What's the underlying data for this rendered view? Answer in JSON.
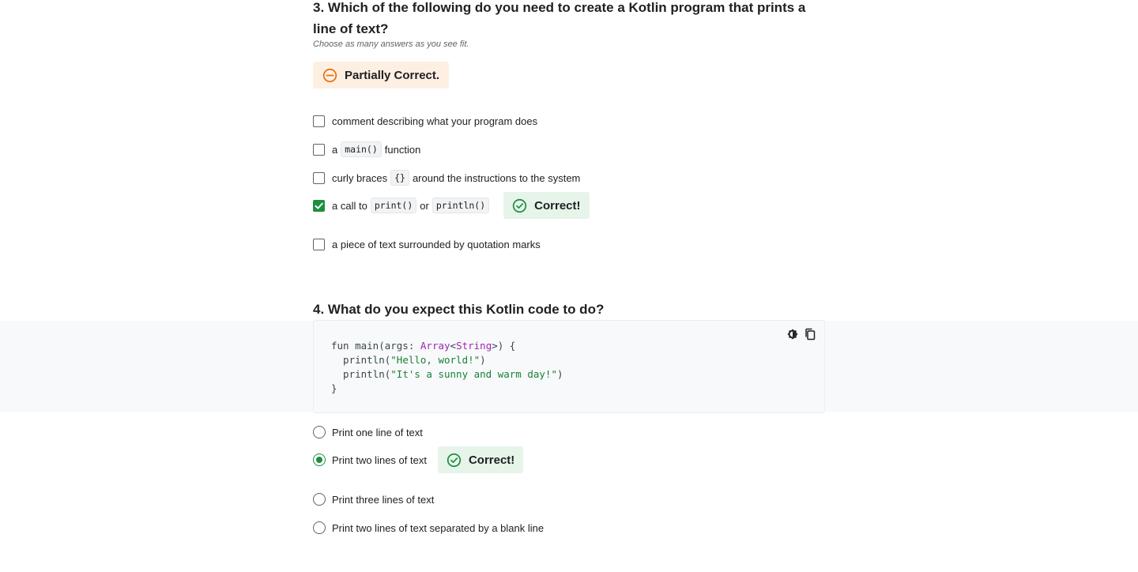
{
  "q3": {
    "title": "3. Which of the following do you need to create a Kotlin program that prints a line of text?",
    "hint": "Choose as many answers as you see fit.",
    "result": "Partially Correct.",
    "options": [
      {
        "label": "comment describing what your program does",
        "checked": false
      },
      {
        "pre": "a",
        "code": "main()",
        "post": "function",
        "checked": false
      },
      {
        "pre": "curly braces",
        "code": "{}",
        "post": "around the instructions to the system",
        "checked": false
      },
      {
        "pre": "a call to",
        "code": "print()",
        "mid": "or",
        "code2": "println()",
        "checked": true,
        "feedback": "Correct!"
      },
      {
        "label": "a piece of text surrounded by quotation marks",
        "checked": false
      }
    ]
  },
  "q4": {
    "title": "4. What do you expect this Kotlin code to do?",
    "code": {
      "line1_a": "fun main(args: ",
      "line1_type1": "Array",
      "line1_b": "<",
      "line1_type2": "String",
      "line1_c": ">) {",
      "line2_a": "  println(",
      "line2_str": "\"Hello, world!\"",
      "line2_b": ")",
      "line3_a": "  println(",
      "line3_str": "\"It's a sunny and warm day!\"",
      "line3_b": ")",
      "line4": "}"
    },
    "tools": [
      "theme-toggle-icon",
      "copy-icon"
    ],
    "options": [
      {
        "label": "Print one line of text",
        "selected": false
      },
      {
        "label": "Print two lines of text",
        "selected": true,
        "feedback": "Correct!"
      },
      {
        "label": "Print three lines of text",
        "selected": false
      },
      {
        "label": "Print two lines of text separated by a blank line",
        "selected": false
      }
    ]
  },
  "colors": {
    "correct": "#1e8e3e",
    "partial": "#e8710a",
    "correct_bg": "#e6f4ea",
    "partial_bg": "#feefe3"
  }
}
